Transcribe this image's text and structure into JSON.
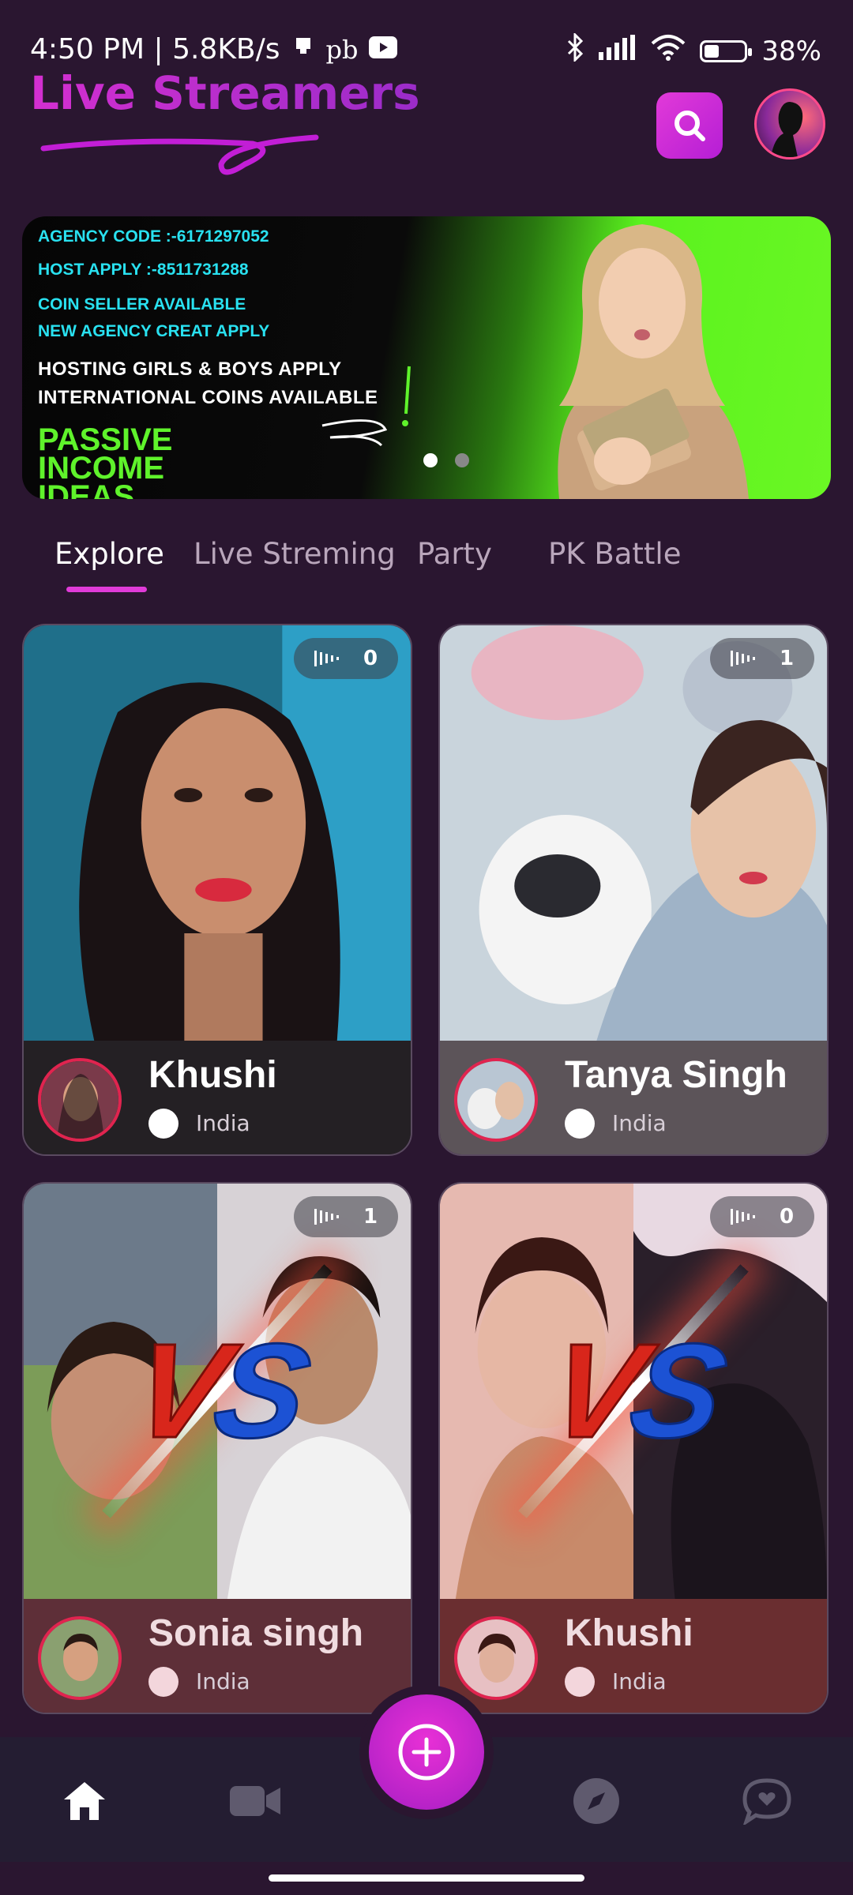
{
  "status_bar": {
    "time_net": "4:50 PM | 5.8KB/s",
    "extra": "pb",
    "battery": "38%",
    "battery_level": 0.38
  },
  "header": {
    "title": "Live Streamers"
  },
  "banner": {
    "lines": [
      "AGENCY CODE :-6171297052",
      "HOST APPLY :-8511731288",
      "COIN SELLER AVAILABLE",
      "NEW AGENCY CREAT APPLY",
      "HOSTING GIRLS & BOYS APPLY",
      "INTERNATIONAL COINS AVAILABLE"
    ],
    "slogan": [
      "PASSIVE",
      "INCOME",
      "IDEAS"
    ],
    "slide_count": 2,
    "active_slide": 1
  },
  "tabs": [
    "Explore",
    "Live Streming",
    "Party",
    "PK Battle"
  ],
  "active_tab": "Explore",
  "cards": [
    {
      "name": "Khushi",
      "country": "India",
      "viewers": "0",
      "type": "live"
    },
    {
      "name": "Tanya Singh",
      "country": "India",
      "viewers": "1",
      "type": "live"
    },
    {
      "name": "Sonia singh",
      "country": "India",
      "viewers": "1",
      "type": "pk"
    },
    {
      "name": "Khushi",
      "country": "India",
      "viewers": "0",
      "type": "pk"
    }
  ],
  "vs_label": "VS",
  "bottom_nav": [
    "home-icon",
    "video-icon",
    "add-icon",
    "compass-icon",
    "chat-icon"
  ],
  "colors": {
    "accent": "#d42fd0",
    "background": "#2a1630",
    "nav": "#241d32"
  }
}
